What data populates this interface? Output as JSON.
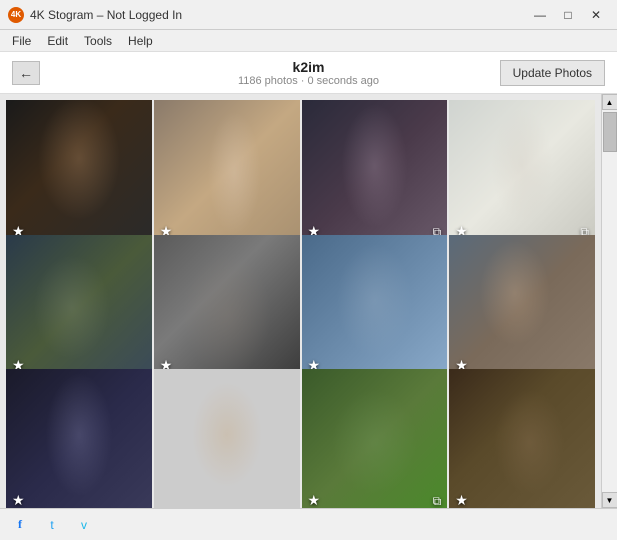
{
  "window": {
    "title": "4K Stogram – Not Logged In",
    "icon": "4K"
  },
  "titlebar": {
    "minimize_label": "—",
    "maximize_label": "□",
    "close_label": "✕"
  },
  "menubar": {
    "items": [
      {
        "id": "file",
        "label": "File"
      },
      {
        "id": "edit",
        "label": "Edit"
      },
      {
        "id": "tools",
        "label": "Tools"
      },
      {
        "id": "help",
        "label": "Help"
      }
    ]
  },
  "toolbar": {
    "back_label": "←",
    "profile_name": "k2im",
    "profile_meta": "1186 photos · 0 seconds ago",
    "update_button_label": "Update Photos"
  },
  "photos": {
    "items": [
      {
        "id": 1,
        "has_star": true,
        "has_copy": false
      },
      {
        "id": 2,
        "has_star": true,
        "has_copy": false
      },
      {
        "id": 3,
        "has_star": true,
        "has_copy": true
      },
      {
        "id": 4,
        "has_star": true,
        "has_copy": true
      },
      {
        "id": 5,
        "has_star": true,
        "has_copy": false
      },
      {
        "id": 6,
        "has_star": true,
        "has_copy": false
      },
      {
        "id": 7,
        "has_star": true,
        "has_copy": false
      },
      {
        "id": 8,
        "has_star": true,
        "has_copy": false
      },
      {
        "id": 9,
        "has_star": false,
        "has_copy": false
      },
      {
        "id": 10,
        "has_star": false,
        "has_copy": false
      },
      {
        "id": 11,
        "has_star": true,
        "has_copy": false
      },
      {
        "id": 12,
        "has_star": true,
        "has_copy": false
      }
    ]
  },
  "statusbar": {
    "facebook_label": "f",
    "twitter_label": "t",
    "vimeo_label": "v"
  }
}
